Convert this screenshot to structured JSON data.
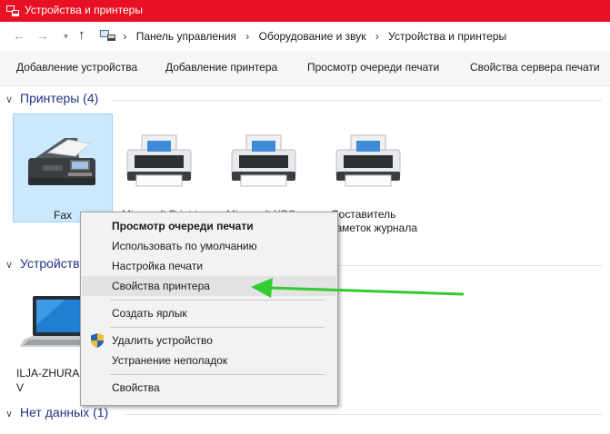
{
  "window": {
    "title": "Устройства и принтеры",
    "accent": "#e81123"
  },
  "nav": {
    "back_icon": "arrow-left-icon",
    "forward_icon": "arrow-right-icon",
    "recent_icon": "chevron-down-icon",
    "up_icon": "arrow-up-icon"
  },
  "breadcrumb": [
    "Панель управления",
    "Оборудование и звук",
    "Устройства и принтеры"
  ],
  "toolbar": {
    "add_device": "Добавление устройства",
    "add_printer": "Добавление принтера",
    "print_queue": "Просмотр очереди печати",
    "server_props": "Свойства сервера печати"
  },
  "groups": {
    "printers": "Принтеры (4)",
    "devices": "Устройства",
    "nodata": "Нет данных (1)"
  },
  "printers": [
    {
      "label": "Fax",
      "selected": true
    },
    {
      "label": "Microsoft Print to",
      "selected": false
    },
    {
      "label": "Microsoft XPS",
      "selected": false
    },
    {
      "label": "Составитель заметок журнала",
      "selected": false
    }
  ],
  "devices": [
    {
      "label_line1": "ILJA-ZHURA",
      "label_line2": "V"
    }
  ],
  "context_menu": {
    "items": [
      "Просмотр очереди печати",
      "Использовать по умолчанию",
      "Настройка печати",
      "Свойства принтера",
      "Создать ярлык",
      "Удалить устройство",
      "Устранение неполадок",
      "Свойства"
    ],
    "default_item_index": 0,
    "highlighted_index": 3
  },
  "annotation": {
    "arrow_color": "#33cc33"
  }
}
